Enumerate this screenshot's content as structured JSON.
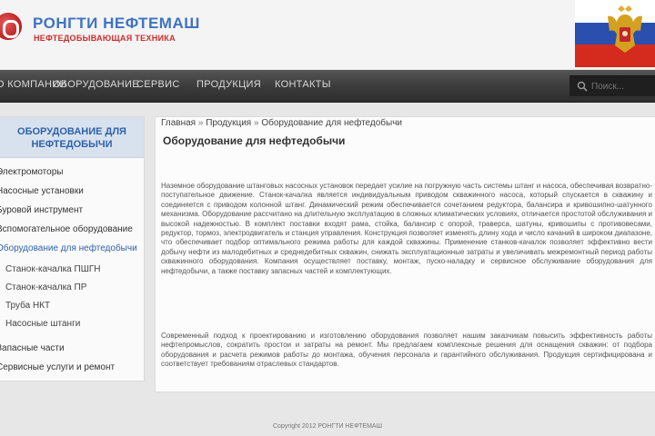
{
  "header": {
    "brand_name": "РОНГТИ НЕФТЕМАШ",
    "brand_subtitle": "НЕФТЕДОБЫВАЮЩАЯ ТЕХНИКА",
    "colors": {
      "brand_blue": "#3f73c2",
      "brand_red": "#d02c2c"
    }
  },
  "nav": {
    "items": [
      "О КОМПАНИИ",
      "ОБОРУДОВАНИЕ",
      "СЕРВИС",
      "ПРОДУКЦИЯ",
      "КОНТАКТЫ"
    ],
    "search_placeholder": "Поиск..."
  },
  "sidebar": {
    "title_line1": "ОБОРУДОВАНИЕ ДЛЯ",
    "title_line2": "НЕФТЕДОБЫЧИ",
    "items": [
      "Электромоторы",
      "Насосные установки",
      "Буровой инструмент",
      "Вспомогательное оборудование",
      "Оборудование для нефтедобычи",
      "Станок-качалка ПШГН",
      "Станок-качалка ПР",
      "Труба НКТ",
      "Насосные штанги",
      "Запасные части",
      "Сервисные услуги и ремонт"
    ]
  },
  "content": {
    "breadcrumb": [
      "Главная",
      "Продукция",
      "Оборудование для нефтедобычи"
    ],
    "title": "Оборудование для нефтедобычи",
    "paragraph1": "Наземное оборудование штанговых насосных установок передает усилие на погружную часть системы штанг и насоса, обеспечивая возвратно-поступательное движение. Станок-качалка является индивидуальным приводом скважинного насоса, который спускается в скважину и соединяется с приводом колонной штанг. Динамический режим обеспечивается сочетанием редуктора, балансира и кривошипно-шатунного механизма. Оборудование рассчитано на длительную эксплуатацию в сложных климатических условиях, отличается простотой обслуживания и высокой надежностью. В комплект поставки входят рама, стойка, балансир с опорой, траверса, шатуны, кривошипы с противовесами, редуктор, тормоз, электродвигатель и станция управления. Конструкция позволяет изменять длину хода и число качаний в широком диапазоне, что обеспечивает подбор оптимального режима работы для каждой скважины. Применение станков-качалок позволяет эффективно вести добычу нефти из малодебитных и среднедебитных скважин, снижать эксплуатационные затраты и увеличивать межремонтный период работы скважинного оборудования. Компания осуществляет поставку, монтаж, пуско-наладку и сервисное обслуживание оборудования для нефтедобычи, а также поставку запасных частей и комплектующих.",
    "paragraph2": "Современный подход к проектированию и изготовлению оборудования позволяет нашим заказчикам повысить эффективность работы нефтепромыслов, сократить простои и затраты на ремонт. Мы предлагаем комплексные решения для оснащения скважин: от подбора оборудования и расчета режимов работы до монтажа, обучения персонала и гарантийного обслуживания. Продукция сертифицирована и соответствует требованиям отраслевых стандартов."
  },
  "footer": {
    "copyright": "Copyright 2012 РОНГТИ НЕФТЕМАШ"
  }
}
